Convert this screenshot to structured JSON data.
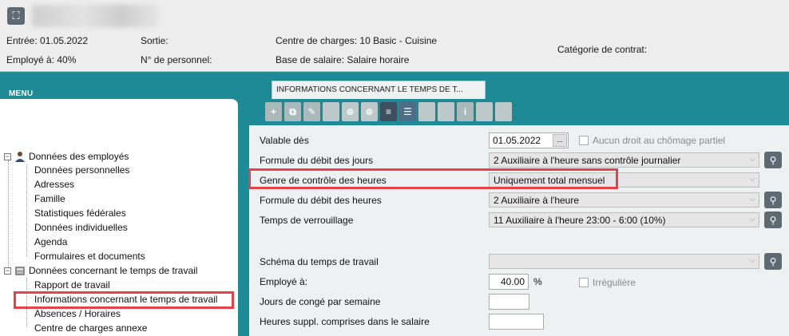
{
  "header": {
    "entree": "Entrée: 01.05.2022",
    "sortie": "Sortie:",
    "centre_charges": "Centre de charges: 10 Basic - Cuisine",
    "employe_a": "Employé à: 40%",
    "numero_personnel": "N° de personnel:",
    "base_salaire": "Base de salaire: Salaire horaire",
    "categorie_contrat": "Catégorie de contrat:"
  },
  "menu": {
    "title": "MENU",
    "groups": [
      {
        "label": "Données des employés",
        "items": [
          "Données personnelles",
          "Adresses",
          "Famille",
          "Statistiques fédérales",
          "Données individuelles",
          "Agenda",
          "Formulaires et documents"
        ]
      },
      {
        "label": "Données concernant le temps de travail",
        "items": [
          "Rapport de travail",
          "Informations concernant le temps de travail",
          "Absences / Horaires",
          "Centre de charges annexe"
        ]
      }
    ]
  },
  "tab": {
    "label": "INFORMATIONS CONCERNANT LE TEMPS DE T..."
  },
  "toolbar": {
    "info_label": "i"
  },
  "form": {
    "valable_des": {
      "label": "Valable dès",
      "value": "01.05.2022",
      "button": "..."
    },
    "aucun_droit": {
      "label": "Aucun droit au chômage partiel"
    },
    "formule_jours": {
      "label": "Formule du débit des jours",
      "value": "2 Auxiliaire à l'heure sans contrôle journalier"
    },
    "genre_controle": {
      "label": "Genre de contrôle des heures",
      "value": "Uniquement total mensuel"
    },
    "formule_heures": {
      "label": "Formule du débit des heures",
      "value": "2 Auxiliaire à l'heure"
    },
    "temps_verrouillage": {
      "label": "Temps de verrouillage",
      "value": "11 Auxiliaire à l'heure 23:00 - 6:00 (10%)"
    },
    "schema_temps": {
      "label": "Schéma du temps de travail",
      "value": ""
    },
    "employe_a": {
      "label": "Employé à:",
      "value": "40.00",
      "unit": "%"
    },
    "irreguliere": {
      "label": "Irrégulière"
    },
    "jours_conge": {
      "label": "Jours de congé par semaine",
      "value": ""
    },
    "heures_suppl": {
      "label": "Heures suppl. comprises dans le salaire",
      "value": ""
    }
  },
  "colors": {
    "background": "#1d8a96",
    "highlight": "#e5434a",
    "toolbar_active": "#4f6e86"
  }
}
